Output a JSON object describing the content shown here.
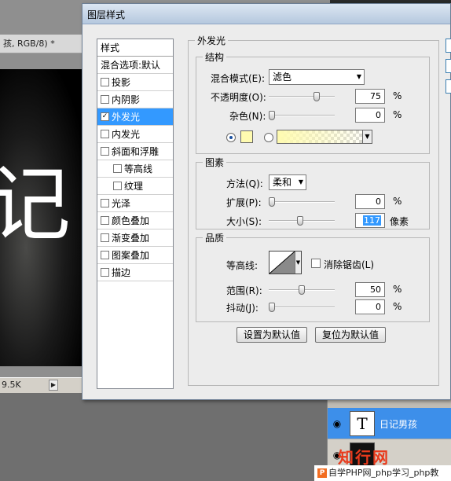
{
  "background": {
    "doc_tab_title": "孩, RGB/8) *",
    "canvas_text": "记",
    "status_text": "9.5K",
    "layers": [
      {
        "thumb": "T",
        "name": "日记男孩",
        "selected": true
      },
      {
        "thumb": "",
        "name": "",
        "selected": false
      }
    ],
    "watermark": "知行网",
    "footer_text": "自学PHP网_php学习_php教"
  },
  "dialog": {
    "title": "图层样式",
    "style_list": {
      "header": "样式",
      "items": [
        {
          "label": "混合选项:默认",
          "kind": "plain",
          "checked": false,
          "selected": false
        },
        {
          "label": "投影",
          "kind": "check",
          "checked": false,
          "selected": false
        },
        {
          "label": "内阴影",
          "kind": "check",
          "checked": false,
          "selected": false
        },
        {
          "label": "外发光",
          "kind": "check",
          "checked": true,
          "selected": true
        },
        {
          "label": "内发光",
          "kind": "check",
          "checked": false,
          "selected": false
        },
        {
          "label": "斜面和浮雕",
          "kind": "check",
          "checked": false,
          "selected": false
        },
        {
          "label": "等高线",
          "kind": "indent",
          "checked": false,
          "selected": false
        },
        {
          "label": "纹理",
          "kind": "indent",
          "checked": false,
          "selected": false
        },
        {
          "label": "光泽",
          "kind": "check",
          "checked": false,
          "selected": false
        },
        {
          "label": "颜色叠加",
          "kind": "check",
          "checked": false,
          "selected": false
        },
        {
          "label": "渐变叠加",
          "kind": "check",
          "checked": false,
          "selected": false
        },
        {
          "label": "图案叠加",
          "kind": "check",
          "checked": false,
          "selected": false
        },
        {
          "label": "描边",
          "kind": "check",
          "checked": false,
          "selected": false
        }
      ]
    },
    "panel_title": "外发光",
    "structure": {
      "title": "结构",
      "blend_mode_label": "混合模式(E):",
      "blend_mode_value": "滤色",
      "opacity_label": "不透明度(O):",
      "opacity_value": "75",
      "opacity_level": 75,
      "noise_label": "杂色(N):",
      "noise_value": "0",
      "noise_level": 0,
      "unit": "%",
      "glow_color": "#fffbb0"
    },
    "elements": {
      "title": "图素",
      "technique_label": "方法(Q):",
      "technique_value": "柔和",
      "spread_label": "扩展(P):",
      "spread_value": "0",
      "spread_level": 0,
      "size_label": "大小(S):",
      "size_value": "117",
      "size_level": 47,
      "percent_unit": "%",
      "size_unit": "像素"
    },
    "quality": {
      "title": "品质",
      "contour_label": "等高线:",
      "anti_alias_label": "消除锯齿(L)",
      "range_label": "范围(R):",
      "range_value": "50",
      "range_level": 50,
      "jitter_label": "抖动(J):",
      "jitter_value": "0",
      "jitter_level": 0,
      "unit": "%"
    },
    "buttons": {
      "make_default": "设置为默认值",
      "reset_default": "复位为默认值"
    }
  }
}
